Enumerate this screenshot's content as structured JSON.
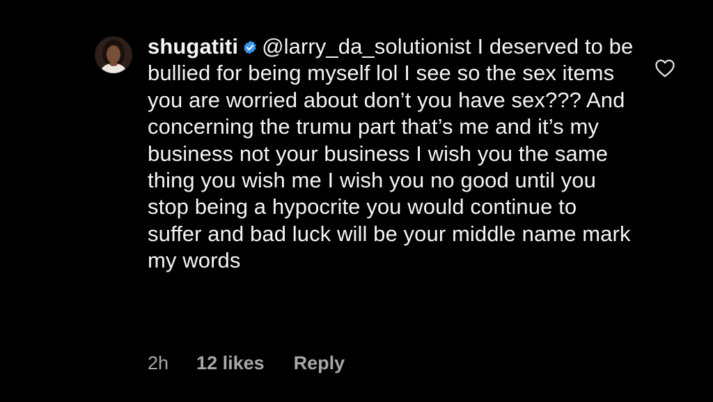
{
  "comment": {
    "username": "shugatiti",
    "verified_icon": "verified-badge-icon",
    "mention": "@larry_da_solutionist",
    "text": "I deserved to be bullied for being myself lol I see so the sex items you are worried about don’t you have sex??? And concerning the trumu part that’s me and it’s my business not your business I wish you the same thing you wish me I wish you no good until you stop being a hypocrite you would continue to suffer and bad luck will be your middle name mark my words",
    "time": "2h",
    "likes": "12 likes",
    "reply_label": "Reply",
    "like_icon": "heart-outline-icon",
    "verified_color": "#3897f0"
  }
}
